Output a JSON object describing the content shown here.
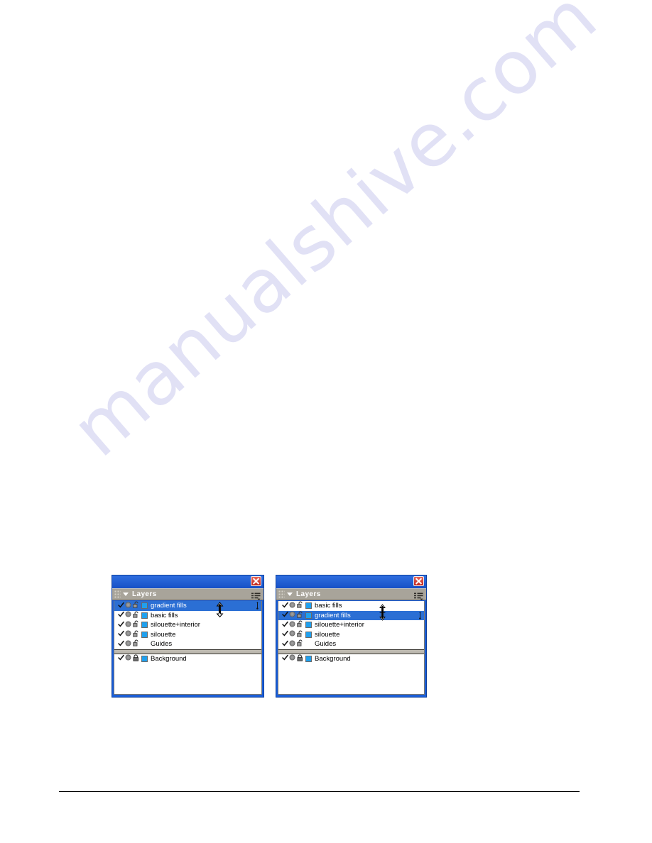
{
  "page": {
    "background_color": "#ffffff",
    "watermark_text": "manualshive.com",
    "watermark_color": "#c9c9ee",
    "footer_rule_color": "#000000"
  },
  "colors": {
    "title_bar": "#1a5ed8",
    "panel_header": "#a8a49a",
    "selection": "#2b6fd4",
    "layer_swatch": "#20a0ee",
    "close_button": "#c0261c"
  },
  "panels": [
    {
      "id": "layers-panel-before",
      "position": "left",
      "title": "Layers",
      "close_label": "Close",
      "options_menu_label": "Options",
      "collapse_label": "Collapse",
      "cursor": "up-arrow",
      "groups": [
        {
          "rows": [
            {
              "name": "gradient fills",
              "selected": true,
              "visible": true,
              "locked": false,
              "editable": true,
              "has_swatch": true,
              "end_mark": true
            },
            {
              "name": "basic fills",
              "selected": false,
              "visible": true,
              "locked": false,
              "editable": true,
              "has_swatch": true,
              "end_mark": false
            },
            {
              "name": "silouette+interior",
              "selected": false,
              "visible": true,
              "locked": false,
              "editable": true,
              "has_swatch": true,
              "end_mark": false
            },
            {
              "name": "silouette",
              "selected": false,
              "visible": true,
              "locked": false,
              "editable": true,
              "has_swatch": true,
              "end_mark": false
            },
            {
              "name": "Guides",
              "selected": false,
              "visible": true,
              "locked": false,
              "editable": true,
              "has_swatch": false,
              "end_mark": false
            }
          ]
        },
        {
          "rows": [
            {
              "name": "Background",
              "selected": false,
              "visible": true,
              "locked": true,
              "editable": true,
              "has_swatch": true,
              "end_mark": false
            }
          ]
        }
      ]
    },
    {
      "id": "layers-panel-after",
      "position": "right",
      "title": "Layers",
      "close_label": "Close",
      "options_menu_label": "Options",
      "collapse_label": "Collapse",
      "cursor": "vertical-resize",
      "groups": [
        {
          "rows": [
            {
              "name": "basic fills",
              "selected": false,
              "visible": true,
              "locked": false,
              "editable": true,
              "has_swatch": true,
              "end_mark": false
            },
            {
              "name": "gradient fills",
              "selected": true,
              "visible": true,
              "locked": false,
              "editable": true,
              "has_swatch": true,
              "end_mark": true
            },
            {
              "name": "silouette+interior",
              "selected": false,
              "visible": true,
              "locked": false,
              "editable": true,
              "has_swatch": true,
              "end_mark": false
            },
            {
              "name": "silouette",
              "selected": false,
              "visible": true,
              "locked": false,
              "editable": true,
              "has_swatch": true,
              "end_mark": false
            },
            {
              "name": "Guides",
              "selected": false,
              "visible": true,
              "locked": false,
              "editable": true,
              "has_swatch": false,
              "end_mark": false
            }
          ]
        },
        {
          "rows": [
            {
              "name": "Background",
              "selected": false,
              "visible": true,
              "locked": true,
              "editable": true,
              "has_swatch": true,
              "end_mark": false
            }
          ]
        }
      ]
    }
  ],
  "icons": {
    "check": "check-icon",
    "pencil": "pencil-icon",
    "eye": "visibility-icon",
    "lock_open": "unlocked-padlock-icon",
    "lock_closed": "locked-padlock-icon",
    "options": "panel-options-icon",
    "close": "close-icon",
    "gripper": "gripper-icon",
    "collapse_triangle": "chevron-down-icon"
  }
}
